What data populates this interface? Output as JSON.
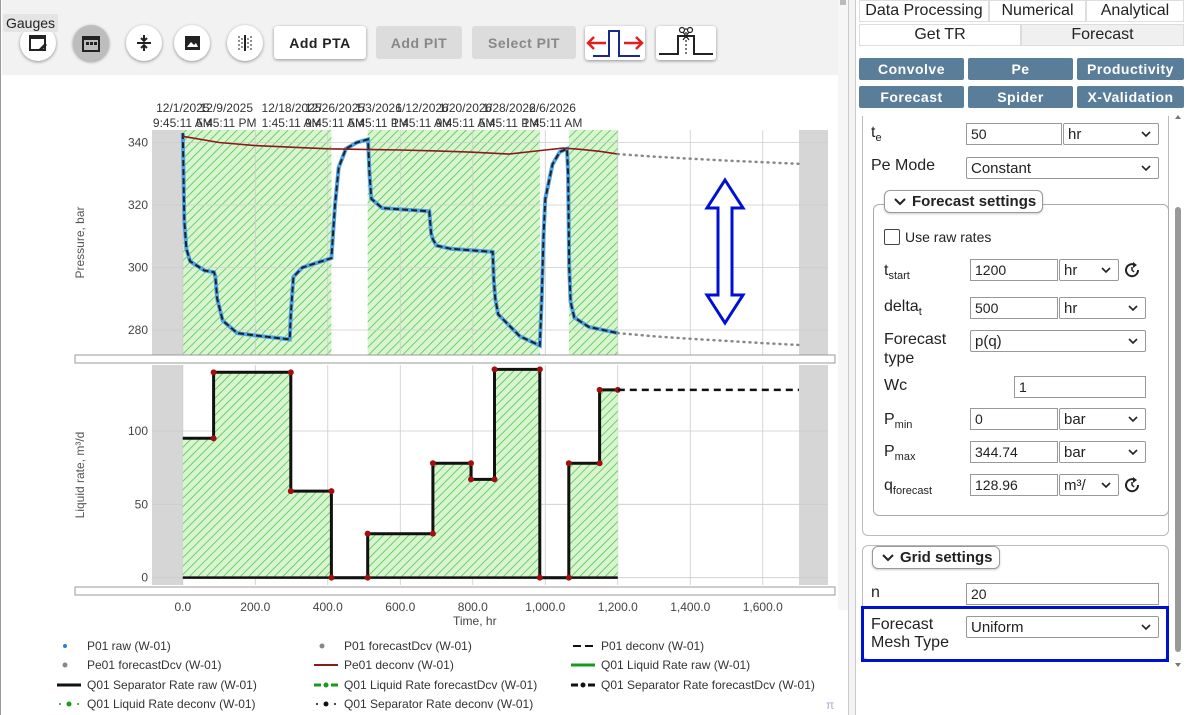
{
  "toolbar": {
    "tooltip": "Gauges",
    "add_pta": "Add PTA",
    "add_pit": "Add PIT",
    "select_pit": "Select PIT"
  },
  "tabs": {
    "row1": [
      "Data Processing",
      "Numerical",
      "Analytical"
    ],
    "get_tr": "Get TR",
    "forecast": "Forecast"
  },
  "sub_buttons": [
    "Convolve",
    "Pe",
    "Productivity",
    "Forecast",
    "Spider",
    "X-Validation"
  ],
  "settings": {
    "te_label": "t",
    "te_sub": "e",
    "te_value": "50",
    "te_unit": "hr",
    "pe_mode_label": "Pe Mode",
    "pe_mode_value": "Constant"
  },
  "forecast_settings": {
    "title": "Forecast settings",
    "use_raw_rates": "Use raw rates",
    "tstart_label": "t",
    "tstart_sub": "start",
    "tstart_value": "1200",
    "tstart_unit": "hr",
    "delta_label": "delta",
    "delta_sub": "t",
    "delta_value": "500",
    "delta_unit": "hr",
    "forecast_type_label": "Forecast type",
    "forecast_type_value": "p(q)",
    "wc_label": "Wc",
    "wc_value": "1",
    "pmin_label": "P",
    "pmin_sub": "min",
    "pmin_value": "0",
    "pmin_unit": "bar",
    "pmax_label": "P",
    "pmax_sub": "max",
    "pmax_value": "344.74",
    "pmax_unit": "bar",
    "qf_label": "q",
    "qf_sub": "forecast",
    "qf_value": "128.96",
    "qf_unit": "m³/"
  },
  "grid_settings": {
    "title": "Grid settings",
    "n_label": "n",
    "n_value": "20",
    "mesh_label": "Forecast Mesh Type",
    "mesh_value": "Uniform"
  },
  "colors": {
    "accent_blue": "#0010d0",
    "sub_button": "#5a7e9a",
    "deconv_red": "#8b1a1a",
    "shade_green": "#4ec64e"
  },
  "chart_data": [
    {
      "type": "line",
      "ylabel": "Pressure, bar",
      "ylim": [
        272,
        344
      ],
      "yticks": [
        280,
        300,
        320,
        340
      ],
      "top_axis": {
        "x": [
          0,
          120,
          300,
          420,
          540,
          660,
          780,
          900,
          1020
        ],
        "labels": [
          [
            "12/1/2025",
            "9:45:11 AM"
          ],
          [
            "12/9/2025",
            "5:45:11 PM"
          ],
          [
            "12/18/2025",
            "1:45:11 AM"
          ],
          [
            "12/26/2025",
            "9:45:11 AM"
          ],
          [
            "1/3/2026",
            "5:45:11 PM"
          ],
          [
            "1/12/2026",
            "1:45:11 AM"
          ],
          [
            "1/20/2026",
            "9:45:11 AM"
          ],
          [
            "1/28/2026",
            "5:45:11 PM"
          ],
          [
            "2/6/2026",
            "1:45:11 AM"
          ]
        ]
      },
      "shaded_intervals": [
        [
          0,
          410
        ],
        [
          510,
          985
        ],
        [
          1065,
          1200
        ]
      ],
      "series": [
        {
          "name": "P01 raw (W-01)",
          "x": [
            0,
            4,
            10,
            20,
            60,
            86,
            90,
            95,
            110,
            150,
            220,
            295,
            298,
            305,
            330,
            410,
            420,
            430,
            450,
            480,
            511,
            515,
            520,
            550,
            680,
            685,
            690,
            700,
            740,
            855,
            858,
            862,
            870,
            930,
            985,
            990,
            995,
            1000,
            1020,
            1040,
            1060,
            1063,
            1066,
            1070,
            1080,
            1120,
            1200
          ],
          "values": [
            343,
            315,
            306,
            302,
            299,
            298.5,
            297,
            290,
            283,
            279,
            278,
            277,
            285,
            297,
            300,
            303,
            320,
            332,
            338,
            340,
            341,
            330,
            322,
            319,
            318,
            311,
            309,
            307,
            306,
            305,
            296,
            290,
            285,
            278,
            275,
            290,
            310,
            322,
            333,
            337,
            338,
            330,
            300,
            289,
            284,
            281,
            279
          ]
        },
        {
          "name": "Pe01 deconv (W-01)",
          "x": [
            0,
            100,
            200,
            300,
            400,
            500,
            600,
            700,
            800,
            900,
            1000,
            1050,
            1100,
            1150,
            1200
          ],
          "values": [
            342,
            340,
            339,
            338.5,
            338,
            337.8,
            337.6,
            337.3,
            336.9,
            336.3,
            337.6,
            338.2,
            337.8,
            337.2,
            336.3
          ]
        },
        {
          "name": "P01 forecastDcv (W-01)",
          "x": [
            1200,
            1300,
            1400,
            1500,
            1600,
            1700
          ],
          "values": [
            279,
            278,
            277.2,
            276.5,
            275.8,
            275.2
          ]
        },
        {
          "name": "Pe01 forecastDcv (W-01)",
          "x": [
            1200,
            1300,
            1400,
            1500,
            1600,
            1700
          ],
          "values": [
            336.3,
            335.5,
            334.8,
            334.2,
            333.7,
            333.2
          ]
        }
      ]
    },
    {
      "type": "line",
      "xlabel": "Time, hr",
      "ylabel": "Liquid rate, m³/d",
      "xlim": [
        -85,
        1780
      ],
      "ylim": [
        -5,
        145
      ],
      "xticks": [
        0,
        200,
        400,
        600,
        800,
        1000,
        1200,
        1400,
        1600
      ],
      "xtick_labels": [
        "0.0",
        "200.0",
        "400.0",
        "600.0",
        "800.0",
        "1,000.0",
        "1,200.0",
        "1,400.0",
        "1,600.0"
      ],
      "yticks": [
        0,
        50,
        100
      ],
      "series": [
        {
          "name": "Q01 Separator Rate raw (W-01)",
          "x": [
            0,
            85,
            85,
            298,
            298,
            410,
            410,
            510,
            510,
            690,
            690,
            795,
            795,
            860,
            860,
            985,
            985,
            1065,
            1065,
            1150,
            1150,
            1200
          ],
          "values": [
            95,
            95,
            140,
            140,
            59,
            59,
            0,
            0,
            30,
            30,
            78,
            78,
            67,
            67,
            142,
            142,
            0,
            0,
            78,
            78,
            128,
            128
          ]
        },
        {
          "name": "Q01 Separator Rate forecastDcv (W-01)",
          "x": [
            1200,
            1700
          ],
          "values": [
            128,
            128
          ]
        }
      ]
    }
  ],
  "legend": [
    "P01 raw (W-01)",
    "P01 forecastDcv (W-01)",
    "P01 deconv (W-01)",
    "Pe01 forecastDcv (W-01)",
    "Pe01 deconv (W-01)",
    "Q01 Liquid Rate raw (W-01)",
    "Q01 Separator Rate raw (W-01)",
    "Q01 Liquid Rate forecastDcv (W-01)",
    "Q01 Separator Rate forecastDcv (W-01)",
    "Q01 Liquid Rate deconv (W-01)",
    "Q01 Separator Rate deconv (W-01)"
  ],
  "watermark": "π"
}
